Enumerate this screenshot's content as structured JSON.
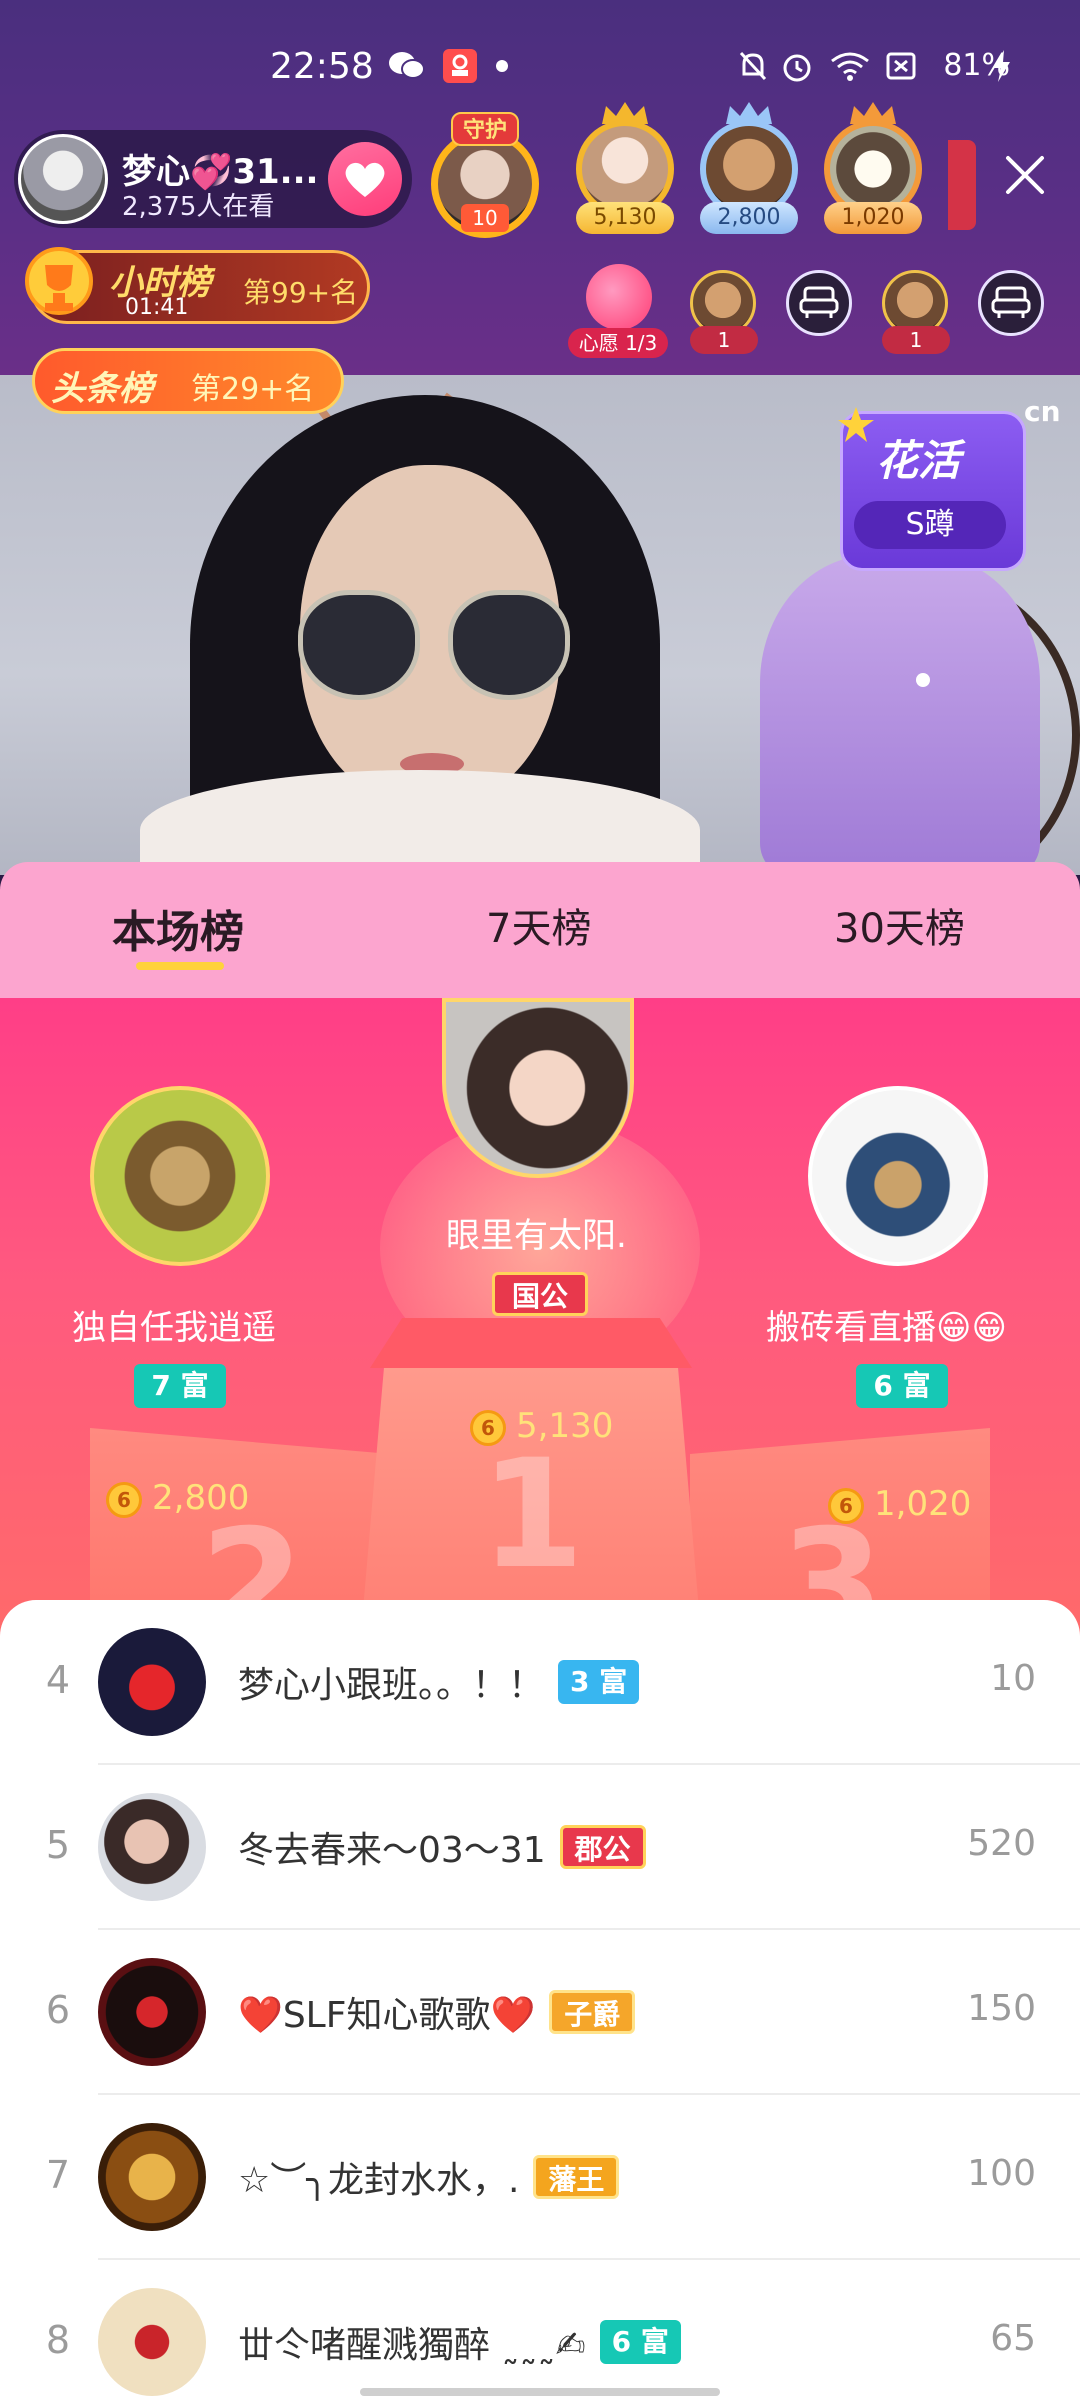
{
  "status_bar": {
    "time": "22:58",
    "battery": "81%"
  },
  "anchor": {
    "name": "梦心💞31...",
    "viewers": "2,375人在看"
  },
  "guard": {
    "label": "守护",
    "count": "10"
  },
  "top_viewers": [
    "5,130",
    "2,800",
    "1,020"
  ],
  "hour_rank": {
    "title": "小时榜",
    "timer": "01:41",
    "rank": "第99+名"
  },
  "headline_rank": {
    "title": "头条榜",
    "rank": "第29+名"
  },
  "wish": {
    "label": "心愿 1/3"
  },
  "seats": [
    "1",
    "1"
  ],
  "activity": {
    "title": "花活",
    "subtitle": "S蹲",
    "tag": "cn"
  },
  "tabs": [
    "本场榜",
    "7天榜",
    "30天榜"
  ],
  "podium": {
    "first": {
      "name": "眼里有太阳.",
      "tag": "国公",
      "amount": "5,130",
      "place": "1"
    },
    "second": {
      "name": "独自任我逍遥",
      "tag": "7 富",
      "amount": "2,800",
      "place": "2"
    },
    "third": {
      "name": "搬砖看直播😁😁",
      "tag": "6 富",
      "amount": "1,020",
      "place": "3"
    }
  },
  "coin_symbol": "6",
  "list": [
    {
      "rank": "4",
      "name": "梦心小跟班。。！！",
      "tag": "3 富",
      "score": "10"
    },
    {
      "rank": "5",
      "name": "冬去春来～03～31",
      "tag": "郡公",
      "score": "520"
    },
    {
      "rank": "6",
      "name": "❤️SLF知心歌歌❤️",
      "tag": "子爵",
      "score": "150"
    },
    {
      "rank": "7",
      "name": "☆︶╮龙封水水，.",
      "tag": "藩王",
      "score": "100"
    },
    {
      "rank": "8",
      "name": "丗仒啫醒溅獨醉 ˷˷˷✍",
      "tag": "6 富",
      "score": "65"
    }
  ],
  "colors": {
    "brand_purple": "#5a2f86",
    "tab_pink": "#fca5cf",
    "podium_pink": "#ff3e87",
    "accent_gold": "#ffd23a"
  }
}
